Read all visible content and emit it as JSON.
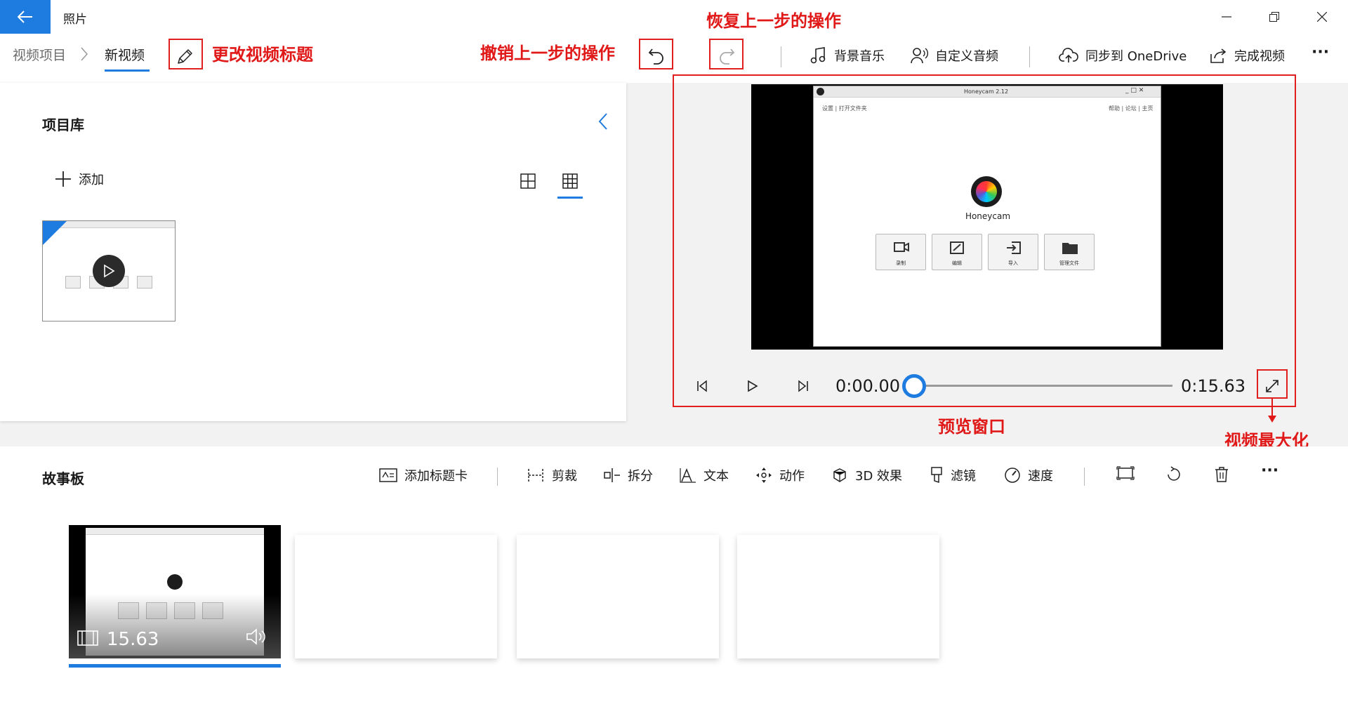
{
  "app": {
    "title": "照片"
  },
  "breadcrumb": {
    "parent": "视频项目",
    "current": "新视频"
  },
  "toolbar": {
    "background_music": "背景音乐",
    "custom_audio": "自定义音频",
    "sync_onedrive": "同步到 OneDrive",
    "finish_video": "完成视频",
    "more": "···"
  },
  "annotations": {
    "rename_title": "更改视频标题",
    "undo": "撤销上一步的操作",
    "redo": "恢复上一步的操作",
    "preview_window": "预览窗口",
    "maximize": "视频最大化"
  },
  "library": {
    "title": "项目库",
    "add_label": "添加"
  },
  "preview": {
    "current_time": "0:00.00",
    "total_time": "0:15.63",
    "progress": 0.0,
    "inner_window": {
      "title": "Honeycam 2.12",
      "menu_left": "设置 | 打开文件夹",
      "menu_right": "帮助 | 论坛 | 主页",
      "app_name": "Honeycam",
      "buttons": [
        "录制",
        "编辑",
        "导入",
        "管理文件"
      ]
    }
  },
  "storyboard": {
    "title": "故事板",
    "tools": {
      "title_card": "添加标题卡",
      "trim": "剪裁",
      "split": "拆分",
      "text": "文本",
      "motion": "动作",
      "effects_3d": "3D 效果",
      "filters": "滤镜",
      "speed": "速度",
      "more": "···"
    },
    "clips": [
      {
        "duration": "15.63"
      }
    ]
  },
  "colors": {
    "accent": "#1e7be0",
    "annotation": "#e01818"
  }
}
